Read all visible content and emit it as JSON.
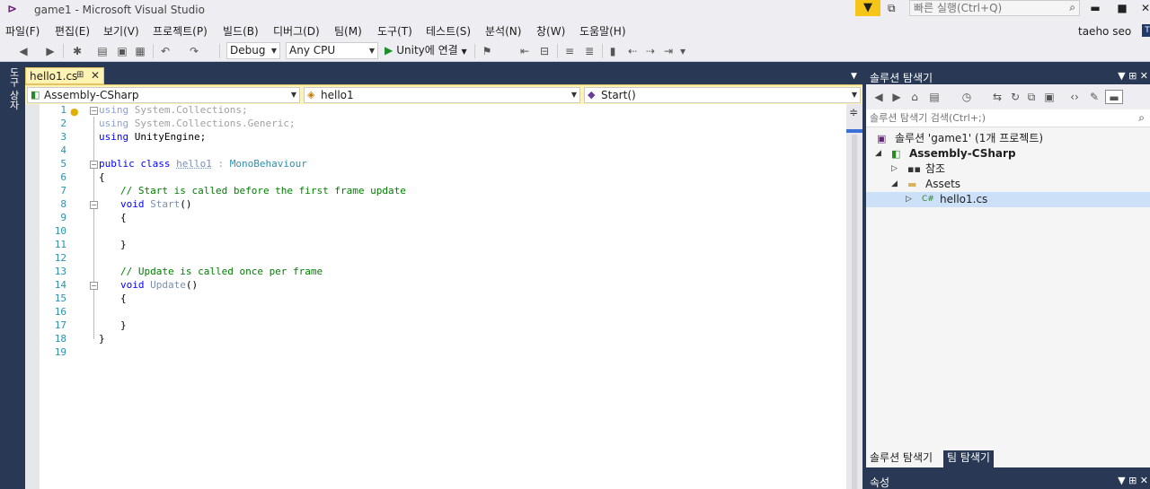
{
  "window": {
    "title": "game1 - Microsoft Visual Studio",
    "quick_launch_placeholder": "빠른 실행(Ctrl+Q)",
    "minimize": "▬",
    "maximize": "■",
    "close": "✕"
  },
  "menu": {
    "items": [
      "파일(F)",
      "편집(E)",
      "보기(V)",
      "프로젝트(P)",
      "빌드(B)",
      "디버그(D)",
      "팀(M)",
      "도구(T)",
      "테스트(S)",
      "분석(N)",
      "창(W)",
      "도움말(H)"
    ],
    "user": "taeho seo",
    "avatar_initial": "T"
  },
  "toolbar": {
    "config": "Debug",
    "platform": "Any CPU",
    "run_label": "Unity에 연결"
  },
  "side_strip": {
    "toolbox_label": "도구 상자"
  },
  "editor": {
    "tab_label": "hello1.cs",
    "nav_project": "Assembly-CSharp",
    "nav_class": "hello1",
    "nav_member": "Start()",
    "line_numbers": [
      "1",
      "2",
      "3",
      "4",
      "5",
      "6",
      "7",
      "8",
      "9",
      "10",
      "11",
      "12",
      "13",
      "14",
      "15",
      "16",
      "17",
      "18",
      "19"
    ],
    "code": {
      "l1_kw": "using",
      "l1_rest": " System.Collections;",
      "l2_kw": "using",
      "l2_rest": " System.Collections.Generic;",
      "l3_kw": "using",
      "l3_rest": " UnityEngine;",
      "l5_kw1": "public",
      "l5_kw2": "class",
      "l5_name": "hello1",
      "l5_colon": " : ",
      "l5_base": "MonoBehaviour",
      "l6": "{",
      "l7": "// Start is called before the first frame update",
      "l8_kw": "void",
      "l8_name": "Start",
      "l8_rest": "()",
      "l9": "{",
      "l11": "}",
      "l13": "// Update is called once per frame",
      "l14_kw": "void",
      "l14_name": "Update",
      "l14_rest": "()",
      "l15": "{",
      "l17": "}",
      "l18": "}"
    }
  },
  "solution_explorer": {
    "title": "솔루션 탐색기",
    "search_placeholder": "솔루션 탐색기 검색(Ctrl+;)",
    "tree": [
      {
        "label": "솔루션 'game1' (1개 프로젝트)"
      },
      {
        "label": "Assembly-CSharp"
      },
      {
        "label": "참조"
      },
      {
        "label": "Assets"
      },
      {
        "label": "hello1.cs"
      }
    ],
    "bottom_tabs": [
      "솔루션 탐색기",
      "팀 탐색기"
    ]
  },
  "properties": {
    "title": "속성"
  },
  "colors": {
    "chrome_bg": "#293955",
    "active_tab": "#fff3b3",
    "selection": "#cce0f7",
    "keyword": "#0000ff",
    "type": "#2b91af",
    "comment": "#008000"
  }
}
